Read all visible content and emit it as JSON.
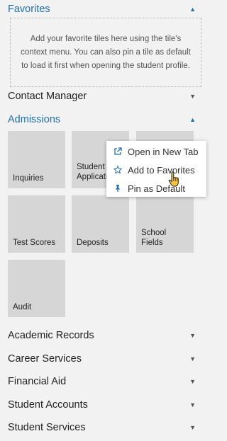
{
  "favorites": {
    "title": "Favorites",
    "empty_message": "Add your favorite tiles here using the tile's context menu. You can also pin a tile as default to load it first when opening the student profile."
  },
  "contact_manager": {
    "title": "Contact Manager"
  },
  "admissions": {
    "title": "Admissions",
    "tiles": [
      "Inquiries",
      "Student Applications",
      "",
      "Test Scores",
      "Deposits",
      "School Fields",
      "Audit"
    ]
  },
  "context_menu": {
    "items": [
      "Open in New Tab",
      "Add to Favorites",
      "Pin as Default"
    ],
    "icons": [
      "external-link-icon",
      "star-icon",
      "pin-icon"
    ]
  },
  "sections": [
    "Academic Records",
    "Career Services",
    "Financial Aid",
    "Student Accounts",
    "Student Services"
  ],
  "colors": {
    "accent": "#1f6fb2",
    "tile_bg": "#d6d6d6",
    "page_bg": "#f2f2f2"
  }
}
